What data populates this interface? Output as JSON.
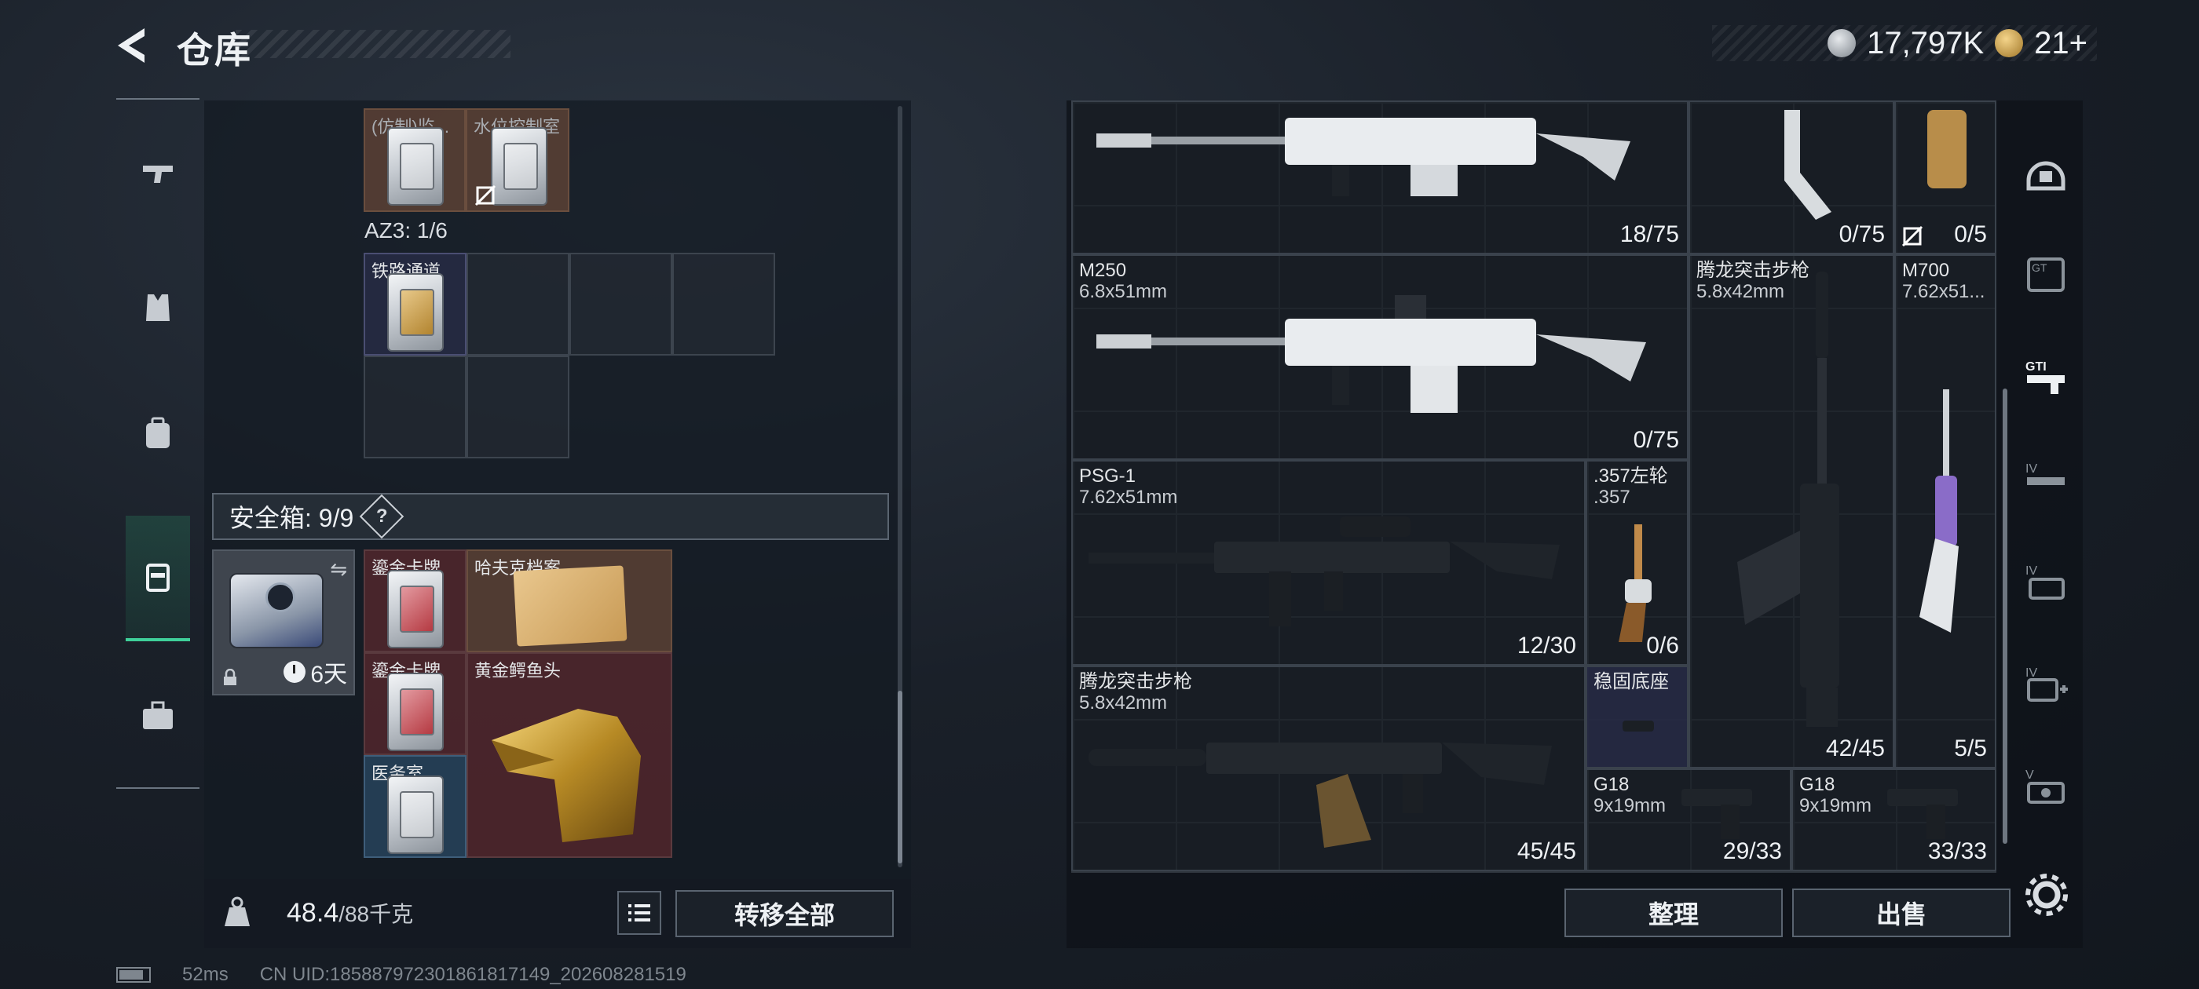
{
  "header": {
    "title": "仓库",
    "currency": [
      {
        "icon": "silver-coin-icon",
        "value": "17,797K"
      },
      {
        "icon": "gold-coin-icon",
        "value": "21+"
      }
    ]
  },
  "left_nav": [
    "weapon-tab",
    "armor-tab",
    "backpack-tab",
    "safebox-tab",
    "case-tab"
  ],
  "stash": {
    "top_cards": [
      {
        "label": "(仿制)监...",
        "color": "brown"
      },
      {
        "label": "水位控制室",
        "color": "brown"
      }
    ],
    "az3_label": "AZ3: 1/6",
    "az3_card": {
      "label": "铁路通道",
      "color": "navy"
    },
    "safebox": {
      "title": "安全箱: 9/9",
      "help": "?",
      "timer": "6天"
    },
    "safe_items": [
      {
        "label": "鎏金卡牌",
        "color": "red"
      },
      {
        "label": "哈夫克档案",
        "color": "brown"
      },
      {
        "label": "鎏金卡牌",
        "color": "red"
      },
      {
        "label": "黄金鳄鱼头",
        "color": "red"
      },
      {
        "label": "医务室",
        "color": "blue"
      }
    ]
  },
  "bottom_left": {
    "weight_value": "48.4",
    "weight_max": "/88千克",
    "transfer_all": "转移全部"
  },
  "status": {
    "ping": "52ms",
    "uid": "CN UID:1858879723018618171­49_202608281519"
  },
  "inventory": {
    "items": [
      {
        "name": "",
        "caliber": "",
        "ammo": "18/75"
      },
      {
        "name": "",
        "caliber": "",
        "ammo": "0/75"
      },
      {
        "name": "",
        "caliber": "",
        "ammo": "0/5"
      },
      {
        "name": "M250",
        "caliber": "6.8x51mm",
        "ammo": "0/75"
      },
      {
        "name": "腾龙突击步枪",
        "caliber": "5.8x42mm",
        "ammo": "42/45"
      },
      {
        "name": "M700",
        "caliber": "7.62x51...",
        "ammo": "5/5"
      },
      {
        "name": "PSG-1",
        "caliber": "7.62x51mm",
        "ammo": "12/30"
      },
      {
        "name": ".357左轮",
        "caliber": ".357",
        "ammo": "0/6"
      },
      {
        "name": "腾龙突击步枪",
        "caliber": "5.8x42mm",
        "ammo": "45/45"
      },
      {
        "name": "稳固底座",
        "caliber": "",
        "ammo": ""
      },
      {
        "name": "G18",
        "caliber": "9x19mm",
        "ammo": "29/33"
      },
      {
        "name": "G18",
        "caliber": "9x19mm",
        "ammo": "33/33"
      }
    ]
  },
  "bottom_right": {
    "sort": "整理",
    "sell": "出售"
  },
  "right_nav": [
    "full-kit-tab",
    "gt-tab",
    "gti-tab",
    "iv-tab",
    "iv-folder-tab",
    "iv-plus-tab",
    "v-tab"
  ]
}
